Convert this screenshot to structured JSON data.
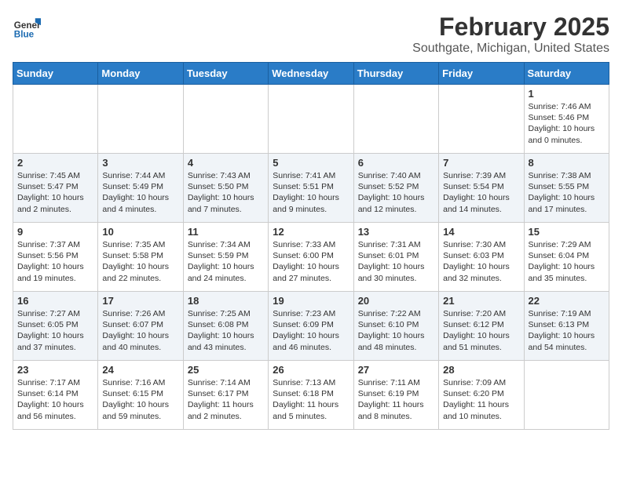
{
  "header": {
    "logo_general": "General",
    "logo_blue": "Blue",
    "title": "February 2025",
    "subtitle": "Southgate, Michigan, United States"
  },
  "weekdays": [
    "Sunday",
    "Monday",
    "Tuesday",
    "Wednesday",
    "Thursday",
    "Friday",
    "Saturday"
  ],
  "weeks": [
    [
      {
        "day": "",
        "info": ""
      },
      {
        "day": "",
        "info": ""
      },
      {
        "day": "",
        "info": ""
      },
      {
        "day": "",
        "info": ""
      },
      {
        "day": "",
        "info": ""
      },
      {
        "day": "",
        "info": ""
      },
      {
        "day": "1",
        "info": "Sunrise: 7:46 AM\nSunset: 5:46 PM\nDaylight: 10 hours\nand 0 minutes."
      }
    ],
    [
      {
        "day": "2",
        "info": "Sunrise: 7:45 AM\nSunset: 5:47 PM\nDaylight: 10 hours\nand 2 minutes."
      },
      {
        "day": "3",
        "info": "Sunrise: 7:44 AM\nSunset: 5:49 PM\nDaylight: 10 hours\nand 4 minutes."
      },
      {
        "day": "4",
        "info": "Sunrise: 7:43 AM\nSunset: 5:50 PM\nDaylight: 10 hours\nand 7 minutes."
      },
      {
        "day": "5",
        "info": "Sunrise: 7:41 AM\nSunset: 5:51 PM\nDaylight: 10 hours\nand 9 minutes."
      },
      {
        "day": "6",
        "info": "Sunrise: 7:40 AM\nSunset: 5:52 PM\nDaylight: 10 hours\nand 12 minutes."
      },
      {
        "day": "7",
        "info": "Sunrise: 7:39 AM\nSunset: 5:54 PM\nDaylight: 10 hours\nand 14 minutes."
      },
      {
        "day": "8",
        "info": "Sunrise: 7:38 AM\nSunset: 5:55 PM\nDaylight: 10 hours\nand 17 minutes."
      }
    ],
    [
      {
        "day": "9",
        "info": "Sunrise: 7:37 AM\nSunset: 5:56 PM\nDaylight: 10 hours\nand 19 minutes."
      },
      {
        "day": "10",
        "info": "Sunrise: 7:35 AM\nSunset: 5:58 PM\nDaylight: 10 hours\nand 22 minutes."
      },
      {
        "day": "11",
        "info": "Sunrise: 7:34 AM\nSunset: 5:59 PM\nDaylight: 10 hours\nand 24 minutes."
      },
      {
        "day": "12",
        "info": "Sunrise: 7:33 AM\nSunset: 6:00 PM\nDaylight: 10 hours\nand 27 minutes."
      },
      {
        "day": "13",
        "info": "Sunrise: 7:31 AM\nSunset: 6:01 PM\nDaylight: 10 hours\nand 30 minutes."
      },
      {
        "day": "14",
        "info": "Sunrise: 7:30 AM\nSunset: 6:03 PM\nDaylight: 10 hours\nand 32 minutes."
      },
      {
        "day": "15",
        "info": "Sunrise: 7:29 AM\nSunset: 6:04 PM\nDaylight: 10 hours\nand 35 minutes."
      }
    ],
    [
      {
        "day": "16",
        "info": "Sunrise: 7:27 AM\nSunset: 6:05 PM\nDaylight: 10 hours\nand 37 minutes."
      },
      {
        "day": "17",
        "info": "Sunrise: 7:26 AM\nSunset: 6:07 PM\nDaylight: 10 hours\nand 40 minutes."
      },
      {
        "day": "18",
        "info": "Sunrise: 7:25 AM\nSunset: 6:08 PM\nDaylight: 10 hours\nand 43 minutes."
      },
      {
        "day": "19",
        "info": "Sunrise: 7:23 AM\nSunset: 6:09 PM\nDaylight: 10 hours\nand 46 minutes."
      },
      {
        "day": "20",
        "info": "Sunrise: 7:22 AM\nSunset: 6:10 PM\nDaylight: 10 hours\nand 48 minutes."
      },
      {
        "day": "21",
        "info": "Sunrise: 7:20 AM\nSunset: 6:12 PM\nDaylight: 10 hours\nand 51 minutes."
      },
      {
        "day": "22",
        "info": "Sunrise: 7:19 AM\nSunset: 6:13 PM\nDaylight: 10 hours\nand 54 minutes."
      }
    ],
    [
      {
        "day": "23",
        "info": "Sunrise: 7:17 AM\nSunset: 6:14 PM\nDaylight: 10 hours\nand 56 minutes."
      },
      {
        "day": "24",
        "info": "Sunrise: 7:16 AM\nSunset: 6:15 PM\nDaylight: 10 hours\nand 59 minutes."
      },
      {
        "day": "25",
        "info": "Sunrise: 7:14 AM\nSunset: 6:17 PM\nDaylight: 11 hours\nand 2 minutes."
      },
      {
        "day": "26",
        "info": "Sunrise: 7:13 AM\nSunset: 6:18 PM\nDaylight: 11 hours\nand 5 minutes."
      },
      {
        "day": "27",
        "info": "Sunrise: 7:11 AM\nSunset: 6:19 PM\nDaylight: 11 hours\nand 8 minutes."
      },
      {
        "day": "28",
        "info": "Sunrise: 7:09 AM\nSunset: 6:20 PM\nDaylight: 11 hours\nand 10 minutes."
      },
      {
        "day": "",
        "info": ""
      }
    ]
  ]
}
